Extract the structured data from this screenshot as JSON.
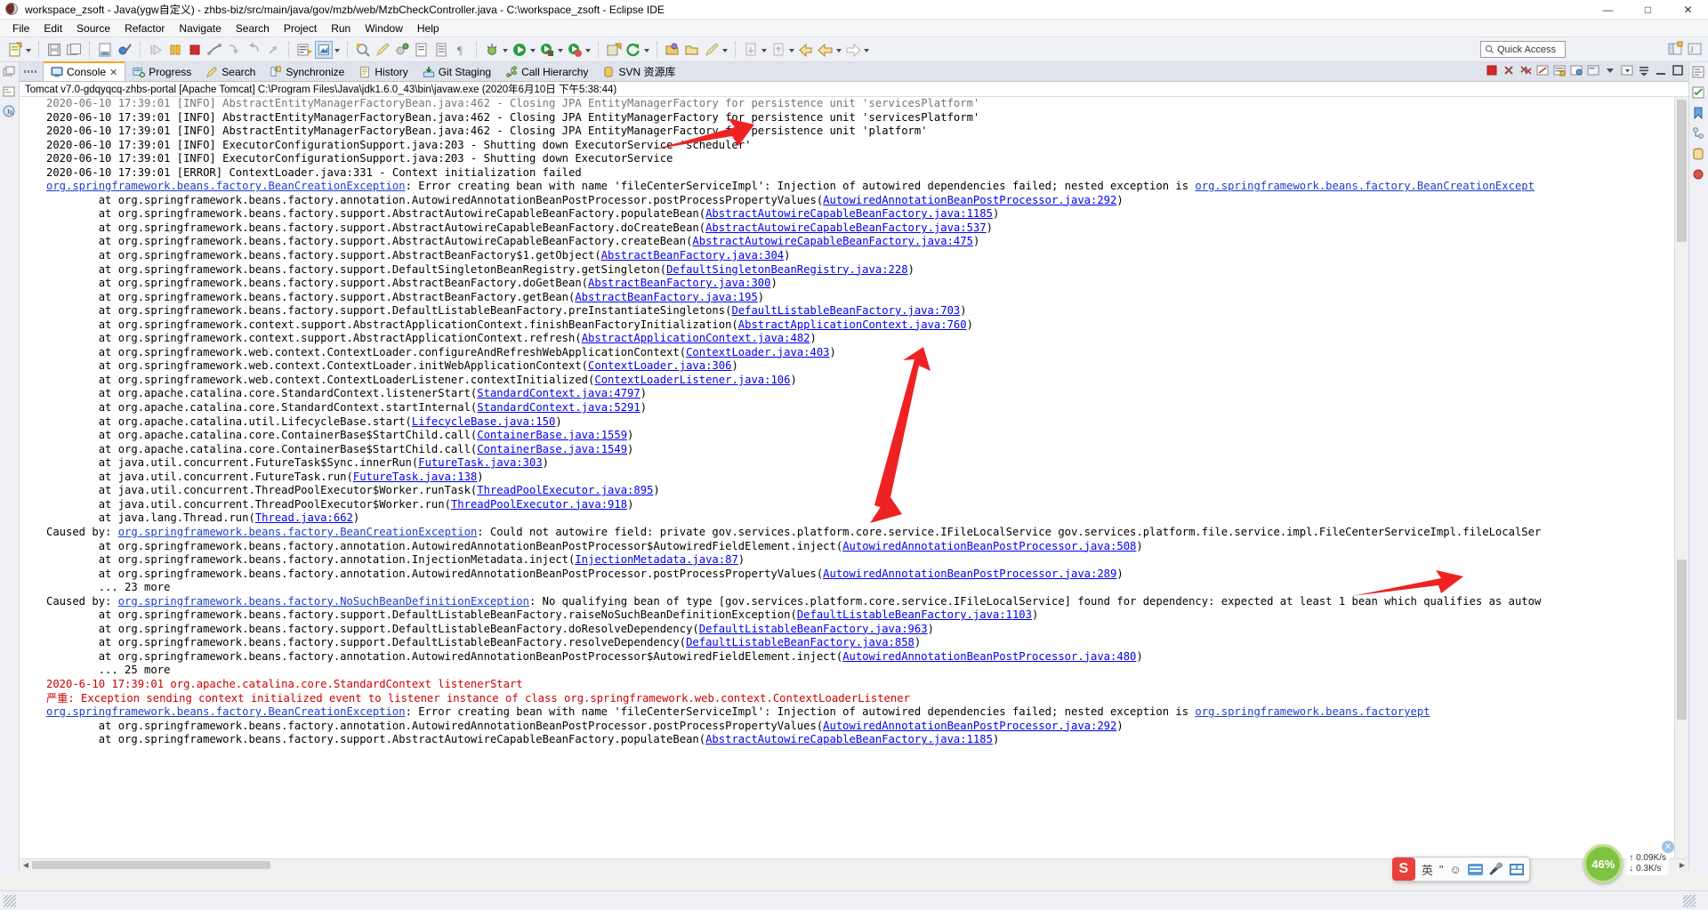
{
  "window": {
    "title": "workspace_zsoft - Java(ygw自定义) - zhbs-biz/src/main/java/gov/mzb/web/MzbCheckController.java - C:\\workspace_zsoft - Eclipse IDE",
    "minimize": "—",
    "maximize": "□",
    "close": "✕"
  },
  "menu": [
    "File",
    "Edit",
    "Source",
    "Refactor",
    "Navigate",
    "Search",
    "Project",
    "Run",
    "Window",
    "Help"
  ],
  "toolbar": {
    "quick_access_placeholder": "Quick Access"
  },
  "tabs": [
    {
      "label": "Console",
      "icon": "console-icon",
      "active": true
    },
    {
      "label": "Progress",
      "icon": "progress-icon",
      "active": false
    },
    {
      "label": "Search",
      "icon": "search-icon",
      "active": false
    },
    {
      "label": "Synchronize",
      "icon": "synchronize-icon",
      "active": false
    },
    {
      "label": "History",
      "icon": "history-icon",
      "active": false
    },
    {
      "label": "Git Staging",
      "icon": "git-staging-icon",
      "active": false
    },
    {
      "label": "Call Hierarchy",
      "icon": "call-hierarchy-icon",
      "active": false
    },
    {
      "label": "SVN 资源库",
      "icon": "svn-repository-icon",
      "active": false
    }
  ],
  "console": {
    "header": "Tomcat v7.0-gdqyqcq-zhbs-portal [Apache Tomcat] C:\\Program Files\\Java\\jdk1.6.0_43\\bin\\javaw.exe (2020年6月10日 下午5:38:44)",
    "lines": [
      {
        "type": "plain",
        "clipped": true,
        "text": "2020-06-10 17:39:01 [INFO] AbstractEntityManagerFactoryBean.java:462 - Closing JPA EntityManagerFactory for persistence unit 'servicesPlatform'"
      },
      {
        "type": "plain",
        "text": "2020-06-10 17:39:01 [INFO] AbstractEntityManagerFactoryBean.java:462 - Closing JPA EntityManagerFactory for persistence unit 'servicesPlatform'"
      },
      {
        "type": "plain",
        "text": "2020-06-10 17:39:01 [INFO] AbstractEntityManagerFactoryBean.java:462 - Closing JPA EntityManagerFactory for persistence unit 'platform'"
      },
      {
        "type": "plain",
        "text": "2020-06-10 17:39:01 [INFO] ExecutorConfigurationSupport.java:203 - Shutting down ExecutorService 'scheduler'"
      },
      {
        "type": "plain",
        "text": "2020-06-10 17:39:01 [INFO] ExecutorConfigurationSupport.java:203 - Shutting down ExecutorService"
      },
      {
        "type": "plain",
        "text": "2020-06-10 17:39:01 [ERROR] ContextLoader.java:331 - Context initialization failed"
      },
      {
        "type": "exception",
        "link": "org.springframework.beans.factory.BeanCreationException",
        "text": ": Error creating bean with name 'fileCenterServiceImpl': Injection of autowired dependencies failed; nested exception is ",
        "link2": "org.springframework.beans.factory.BeanCreationExcept"
      },
      {
        "type": "at",
        "text": "at org.springframework.beans.factory.annotation.AutowiredAnnotationBeanPostProcessor.postProcessPropertyValues(",
        "link": "AutowiredAnnotationBeanPostProcessor.java:292",
        "tail": ")"
      },
      {
        "type": "at",
        "text": "at org.springframework.beans.factory.support.AbstractAutowireCapableBeanFactory.populateBean(",
        "link": "AbstractAutowireCapableBeanFactory.java:1185",
        "tail": ")"
      },
      {
        "type": "at",
        "text": "at org.springframework.beans.factory.support.AbstractAutowireCapableBeanFactory.doCreateBean(",
        "link": "AbstractAutowireCapableBeanFactory.java:537",
        "tail": ")"
      },
      {
        "type": "at",
        "text": "at org.springframework.beans.factory.support.AbstractAutowireCapableBeanFactory.createBean(",
        "link": "AbstractAutowireCapableBeanFactory.java:475",
        "tail": ")"
      },
      {
        "type": "at",
        "text": "at org.springframework.beans.factory.support.AbstractBeanFactory$1.getObject(",
        "link": "AbstractBeanFactory.java:304",
        "tail": ")"
      },
      {
        "type": "at",
        "text": "at org.springframework.beans.factory.support.DefaultSingletonBeanRegistry.getSingleton(",
        "link": "DefaultSingletonBeanRegistry.java:228",
        "tail": ")"
      },
      {
        "type": "at",
        "text": "at org.springframework.beans.factory.support.AbstractBeanFactory.doGetBean(",
        "link": "AbstractBeanFactory.java:300",
        "tail": ")"
      },
      {
        "type": "at",
        "text": "at org.springframework.beans.factory.support.AbstractBeanFactory.getBean(",
        "link": "AbstractBeanFactory.java:195",
        "tail": ")"
      },
      {
        "type": "at",
        "text": "at org.springframework.beans.factory.support.DefaultListableBeanFactory.preInstantiateSingletons(",
        "link": "DefaultListableBeanFactory.java:703",
        "tail": ")"
      },
      {
        "type": "at",
        "text": "at org.springframework.context.support.AbstractApplicationContext.finishBeanFactoryInitialization(",
        "link": "AbstractApplicationContext.java:760",
        "tail": ")"
      },
      {
        "type": "at",
        "text": "at org.springframework.context.support.AbstractApplicationContext.refresh(",
        "link": "AbstractApplicationContext.java:482",
        "tail": ")"
      },
      {
        "type": "at",
        "text": "at org.springframework.web.context.ContextLoader.configureAndRefreshWebApplicationContext(",
        "link": "ContextLoader.java:403",
        "tail": ")"
      },
      {
        "type": "at",
        "text": "at org.springframework.web.context.ContextLoader.initWebApplicationContext(",
        "link": "ContextLoader.java:306",
        "tail": ")"
      },
      {
        "type": "at",
        "text": "at org.springframework.web.context.ContextLoaderListener.contextInitialized(",
        "link": "ContextLoaderListener.java:106",
        "tail": ")"
      },
      {
        "type": "at",
        "text": "at org.apache.catalina.core.StandardContext.listenerStart(",
        "link": "StandardContext.java:4797",
        "tail": ")"
      },
      {
        "type": "at",
        "text": "at org.apache.catalina.core.StandardContext.startInternal(",
        "link": "StandardContext.java:5291",
        "tail": ")"
      },
      {
        "type": "at",
        "text": "at org.apache.catalina.util.LifecycleBase.start(",
        "link": "LifecycleBase.java:150",
        "tail": ")"
      },
      {
        "type": "at",
        "text": "at org.apache.catalina.core.ContainerBase$StartChild.call(",
        "link": "ContainerBase.java:1559",
        "tail": ")"
      },
      {
        "type": "at",
        "text": "at org.apache.catalina.core.ContainerBase$StartChild.call(",
        "link": "ContainerBase.java:1549",
        "tail": ")"
      },
      {
        "type": "at",
        "text": "at java.util.concurrent.FutureTask$Sync.innerRun(",
        "link": "FutureTask.java:303",
        "tail": ")"
      },
      {
        "type": "at",
        "text": "at java.util.concurrent.FutureTask.run(",
        "link": "FutureTask.java:138",
        "tail": ")"
      },
      {
        "type": "at",
        "text": "at java.util.concurrent.ThreadPoolExecutor$Worker.runTask(",
        "link": "ThreadPoolExecutor.java:895",
        "tail": ")"
      },
      {
        "type": "at",
        "text": "at java.util.concurrent.ThreadPoolExecutor$Worker.run(",
        "link": "ThreadPoolExecutor.java:918",
        "tail": ")"
      },
      {
        "type": "at",
        "text": "at java.lang.Thread.run(",
        "link": "Thread.java:662",
        "tail": ")"
      },
      {
        "type": "causedby",
        "prefix": "Caused by: ",
        "link": "org.springframework.beans.factory.BeanCreationException",
        "text": ": Could not autowire field: private gov.services.platform.core.service.IFileLocalService gov.services.platform.file.service.impl.FileCenterServiceImpl.fileLocalSer"
      },
      {
        "type": "at",
        "text": "at org.springframework.beans.factory.annotation.AutowiredAnnotationBeanPostProcessor$AutowiredFieldElement.inject(",
        "link": "AutowiredAnnotationBeanPostProcessor.java:508",
        "tail": ")"
      },
      {
        "type": "at",
        "text": "at org.springframework.beans.factory.annotation.InjectionMetadata.inject(",
        "link": "InjectionMetadata.java:87",
        "tail": ")"
      },
      {
        "type": "at",
        "text": "at org.springframework.beans.factory.annotation.AutowiredAnnotationBeanPostProcessor.postProcessPropertyValues(",
        "link": "AutowiredAnnotationBeanPostProcessor.java:289",
        "tail": ")"
      },
      {
        "type": "more",
        "text": "... 23 more"
      },
      {
        "type": "causedby",
        "prefix": "Caused by: ",
        "link": "org.springframework.beans.factory.NoSuchBeanDefinitionException",
        "text": ": No qualifying bean of type [gov.services.platform.core.service.IFileLocalService] found for dependency: expected at least 1 bean which qualifies as autow"
      },
      {
        "type": "at",
        "text": "at org.springframework.beans.factory.support.DefaultListableBeanFactory.raiseNoSuchBeanDefinitionException(",
        "link": "DefaultListableBeanFactory.java:1103",
        "tail": ")"
      },
      {
        "type": "at",
        "text": "at org.springframework.beans.factory.support.DefaultListableBeanFactory.doResolveDependency(",
        "link": "DefaultListableBeanFactory.java:963",
        "tail": ")"
      },
      {
        "type": "at",
        "text": "at org.springframework.beans.factory.support.DefaultListableBeanFactory.resolveDependency(",
        "link": "DefaultListableBeanFactory.java:858",
        "tail": ")"
      },
      {
        "type": "at",
        "text": "at org.springframework.beans.factory.annotation.AutowiredAnnotationBeanPostProcessor$AutowiredFieldElement.inject(",
        "link": "AutowiredAnnotationBeanPostProcessor.java:480",
        "tail": ")"
      },
      {
        "type": "more",
        "text": "... 25 more"
      },
      {
        "type": "red",
        "text": "2020-6-10 17:39:01 org.apache.catalina.core.StandardContext listenerStart"
      },
      {
        "type": "red",
        "text": "严重: Exception sending context initialized event to listener instance of class org.springframework.web.context.ContextLoaderListener"
      },
      {
        "type": "exception",
        "link": "org.springframework.beans.factory.BeanCreationException",
        "text": ": Error creating bean with name 'fileCenterServiceImpl': Injection of autowired dependencies failed; nested exception is ",
        "link2": "org.springframework.beans.factory",
        "link3": "ept"
      },
      {
        "type": "at",
        "text": "at org.springframework.beans.factory.annotation.AutowiredAnnotationBeanPostProcessor.postProcessPropertyValues(",
        "link": "AutowiredAnnotationBeanPostProcessor.java:292",
        "tail": ")"
      },
      {
        "type": "at",
        "clipped": true,
        "text": "at org.springframework.beans.factory.support.AbstractAutowireCapableBeanFactory.populateBean(",
        "link": "AbstractAutowireCapableBeanFactory.java:1185",
        "tail": ")"
      }
    ]
  },
  "netspeed": {
    "percent": "46%",
    "up": "0.09K/s",
    "down": "0.3K/s",
    "close": "✕"
  },
  "ime": {
    "logo": "S",
    "mode": "英",
    "items": [
      "\"",
      "☺",
      "⌨",
      "🎤",
      "⬛"
    ]
  },
  "colors": {
    "accent_orange": "#f5a623",
    "link_blue": "#0000c0",
    "error_red": "#cc0000",
    "title_blue": "#0a6cc4",
    "tab_bg": "#dfe3ec",
    "toolbar_bg": "#eff1f6",
    "arrow_red": "#ee2222",
    "net_green": "#7fc241"
  }
}
